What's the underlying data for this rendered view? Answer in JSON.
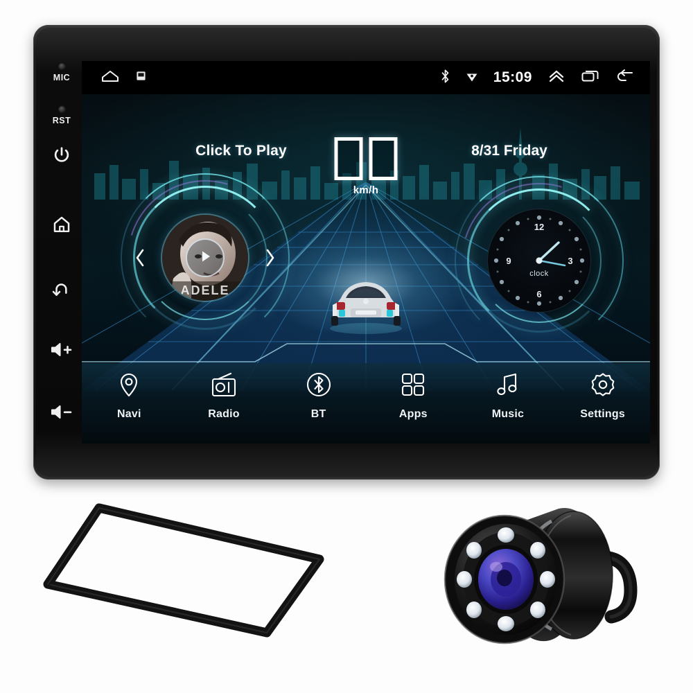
{
  "device": {
    "type": "2-din android car stereo head unit",
    "controls": [
      {
        "label": "MIC",
        "name": "microphone-port"
      },
      {
        "label": "RST",
        "name": "reset-button"
      },
      {
        "label": "",
        "name": "power-button"
      },
      {
        "label": "",
        "name": "home-button"
      },
      {
        "label": "",
        "name": "back-button"
      },
      {
        "label": "",
        "name": "volume-up-button"
      },
      {
        "label": "",
        "name": "volume-down-button"
      }
    ]
  },
  "screen": {
    "status_bar": {
      "time": "15:09",
      "icons": [
        "home-nav-icon",
        "screenshot-icon",
        "bluetooth-status-icon",
        "wifi-signal-icon",
        "chevron-up-icon",
        "recents-icon",
        "back-nav-icon"
      ]
    },
    "music_widget": {
      "hint": "Click To Play",
      "artist": "ADELE"
    },
    "speed": {
      "value": "",
      "unit": "km/h"
    },
    "clock_widget": {
      "date": "8/31  Friday",
      "label": "clock",
      "numerals": [
        "12",
        "3",
        "6",
        "9"
      ]
    },
    "dock": [
      {
        "label": "Navi",
        "icon": "location-pin-icon"
      },
      {
        "label": "Radio",
        "icon": "radio-icon"
      },
      {
        "label": "BT",
        "icon": "bluetooth-icon"
      },
      {
        "label": "Apps",
        "icon": "apps-grid-icon"
      },
      {
        "label": "Music",
        "icon": "music-note-icon"
      },
      {
        "label": "Settings",
        "icon": "gear-icon"
      }
    ]
  },
  "accessories": [
    {
      "name": "dash-mounting-frame",
      "description": "black 2-din dash trim bezel"
    },
    {
      "name": "backup-camera",
      "description": "8 LED night-vision rear view camera"
    }
  ],
  "colors": {
    "screen_accent": "#7fd8e8",
    "screen_background": "#061a22",
    "road_grid": "#2f82b8",
    "dock_background": "#0e2e3e",
    "bezel": "#141414",
    "page_background": "#ffffff",
    "lens": "#4d4bc6"
  }
}
